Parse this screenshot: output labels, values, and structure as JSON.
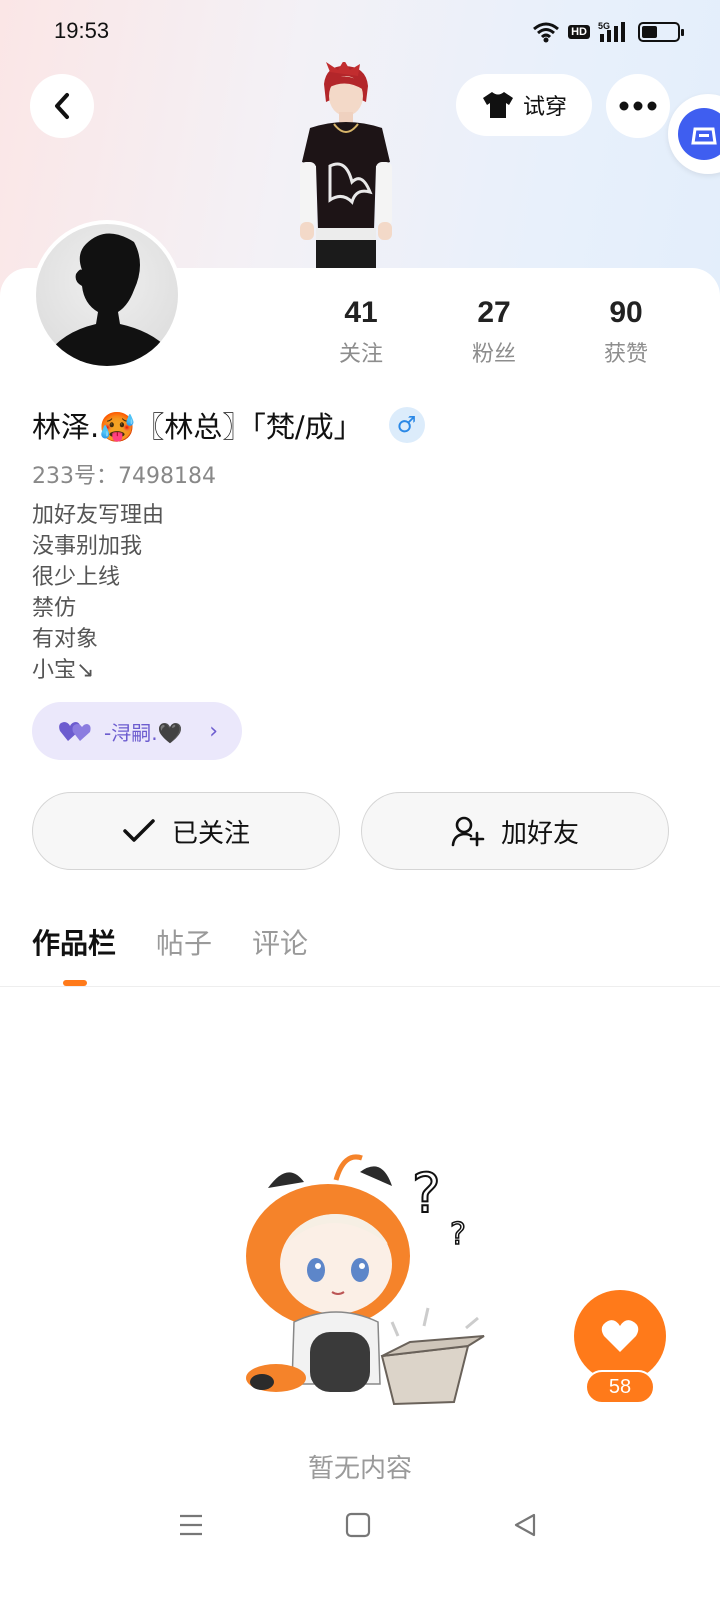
{
  "status_bar": {
    "time": "19:53",
    "network": "5G",
    "hd": "HD",
    "battery_level": 0.45,
    "icons": [
      "wifi-icon",
      "hd-icon",
      "signal-icon",
      "battery-icon"
    ]
  },
  "header": {
    "back_icon": "chevron-left-icon",
    "tryon_label": "试穿",
    "tryon_icon": "tshirt-icon",
    "more_icon": "more-dots-icon",
    "side_tab_icon": "car-icon"
  },
  "profile": {
    "name": "林泽.🥵〖林总〗「梵/成」",
    "gender_symbol": "♂",
    "uid": "233号：7498184",
    "bio": [
      "加好友写理由",
      "没事别加我",
      "很少上线",
      "禁仿",
      "有对象",
      "小宝↘"
    ],
    "stats": [
      {
        "value": "41",
        "label": "关注"
      },
      {
        "value": "27",
        "label": "粉丝"
      },
      {
        "value": "90",
        "label": "获赞"
      }
    ],
    "relation": {
      "text": "-浔嗣.🖤",
      "icon": "heart-pair-icon"
    }
  },
  "actions": {
    "following_label": "已关注",
    "add_friend_label": "加好友"
  },
  "tabs": [
    "作品栏",
    "帖子",
    "评论"
  ],
  "active_tab": 0,
  "empty_text": "暂无内容",
  "like": {
    "count": "58",
    "icon": "heart-icon"
  },
  "colors": {
    "accent": "#ff7a1a",
    "relation": "#6c5ccf",
    "gender": "#2a88e6"
  },
  "navbar": {
    "icons": [
      "menu-icon",
      "home-square-icon",
      "back-triangle-icon"
    ]
  }
}
